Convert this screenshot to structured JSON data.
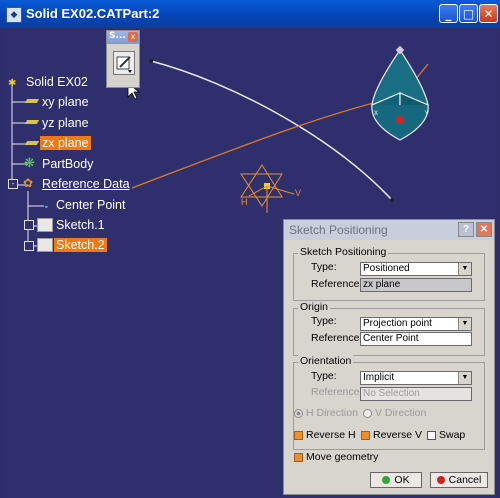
{
  "window": {
    "title": "Solid EX02.CATPart:2",
    "min": "_",
    "max": "□",
    "close": "✕"
  },
  "toolbar": {
    "title": "S...",
    "close": "x"
  },
  "tree": [
    {
      "label": "Solid EX02",
      "state": "normal"
    },
    {
      "label": "xy plane",
      "state": "normal"
    },
    {
      "label": "yz plane",
      "state": "normal"
    },
    {
      "label": "zx plane",
      "state": "selected"
    },
    {
      "label": "PartBody",
      "state": "normal"
    },
    {
      "label": "Reference Data",
      "state": "underline"
    },
    {
      "label": "Center Point",
      "state": "normal"
    },
    {
      "label": "Sketch.1",
      "state": "normal"
    },
    {
      "label": "Sketch.2",
      "state": "selected"
    }
  ],
  "axis": {
    "h": "H",
    "v": "V",
    "x": "x",
    "y": "y"
  },
  "dialog": {
    "title": "Sketch Positioning",
    "help": "?",
    "close": "✕",
    "sketch_positioning": {
      "group": "Sketch Positioning",
      "type_label": "Type:",
      "type_value": "Positioned",
      "ref_label": "Reference:",
      "ref_value": "zx plane"
    },
    "origin": {
      "group": "Origin",
      "type_label": "Type:",
      "type_value": "Projection point",
      "ref_label": "Reference:",
      "ref_value": "Center Point"
    },
    "orientation": {
      "group": "Orientation",
      "type_label": "Type:",
      "type_value": "Implicit",
      "ref_label": "Reference:",
      "ref_value": "No Selection",
      "h_direction": "H Direction",
      "v_direction": "V Direction",
      "reverse_h": "Reverse H",
      "reverse_v": "Reverse V",
      "swap": "Swap"
    },
    "move_geometry": "Move geometry",
    "ok": "OK",
    "cancel": "Cancel"
  },
  "colors": {
    "background": "#2f2f6d",
    "selection": "#f27812",
    "titlebar": "#0543b5",
    "dialog": "#d8d5cf"
  }
}
